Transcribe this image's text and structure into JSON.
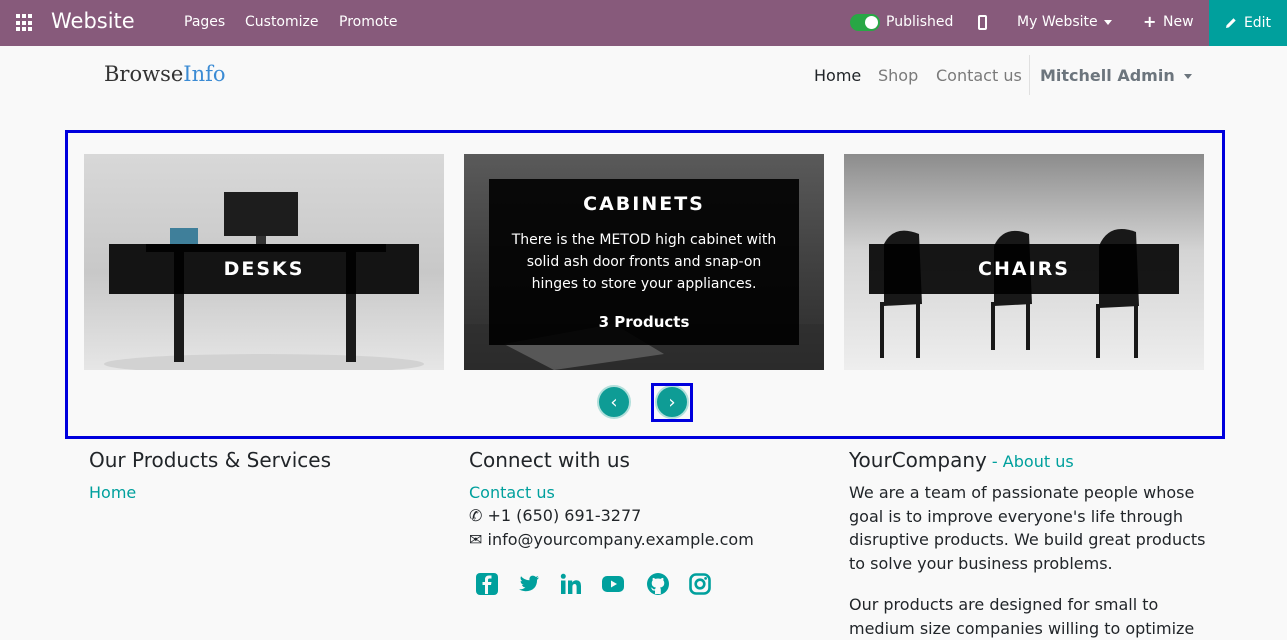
{
  "topbar": {
    "app_title": "Website",
    "menu": [
      "Pages",
      "Customize",
      "Promote"
    ],
    "published_label": "Published",
    "website_selector": "My Website",
    "new_label": "New",
    "edit_label": "Edit"
  },
  "header": {
    "logo_part1": "Browse",
    "logo_part2": "Info",
    "nav": [
      "Home",
      "Shop",
      "Contact us"
    ],
    "user": "Mitchell Admin"
  },
  "carousel": {
    "cards": [
      {
        "title": "DESKS"
      },
      {
        "title": "CABINETS",
        "description": "There is the METOD high cabinet with solid ash door fronts and snap-on hinges to store your appliances.",
        "count": "3 Products"
      },
      {
        "title": "CHAIRS"
      }
    ]
  },
  "footer": {
    "col1": {
      "title": "Our Products & Services",
      "link": "Home"
    },
    "col2": {
      "title": "Connect with us",
      "link": "Contact us",
      "phone": "+1 (650) 691-3277",
      "email": "info@yourcompany.example.com"
    },
    "col3": {
      "title": "YourCompany",
      "title_sep": " - ",
      "about_link": "About us",
      "para1": "We are a team of passionate people whose goal is to improve everyone's life through disruptive products. We build great products to solve your business problems.",
      "para2": "Our products are designed for small to medium size companies willing to optimize"
    },
    "social_icons": [
      "facebook-icon",
      "twitter-icon",
      "linkedin-icon",
      "youtube-icon",
      "github-icon",
      "instagram-icon"
    ]
  },
  "colors": {
    "topbar": "#875a7b",
    "accent": "#00a09d",
    "highlight": "#0000dd"
  }
}
